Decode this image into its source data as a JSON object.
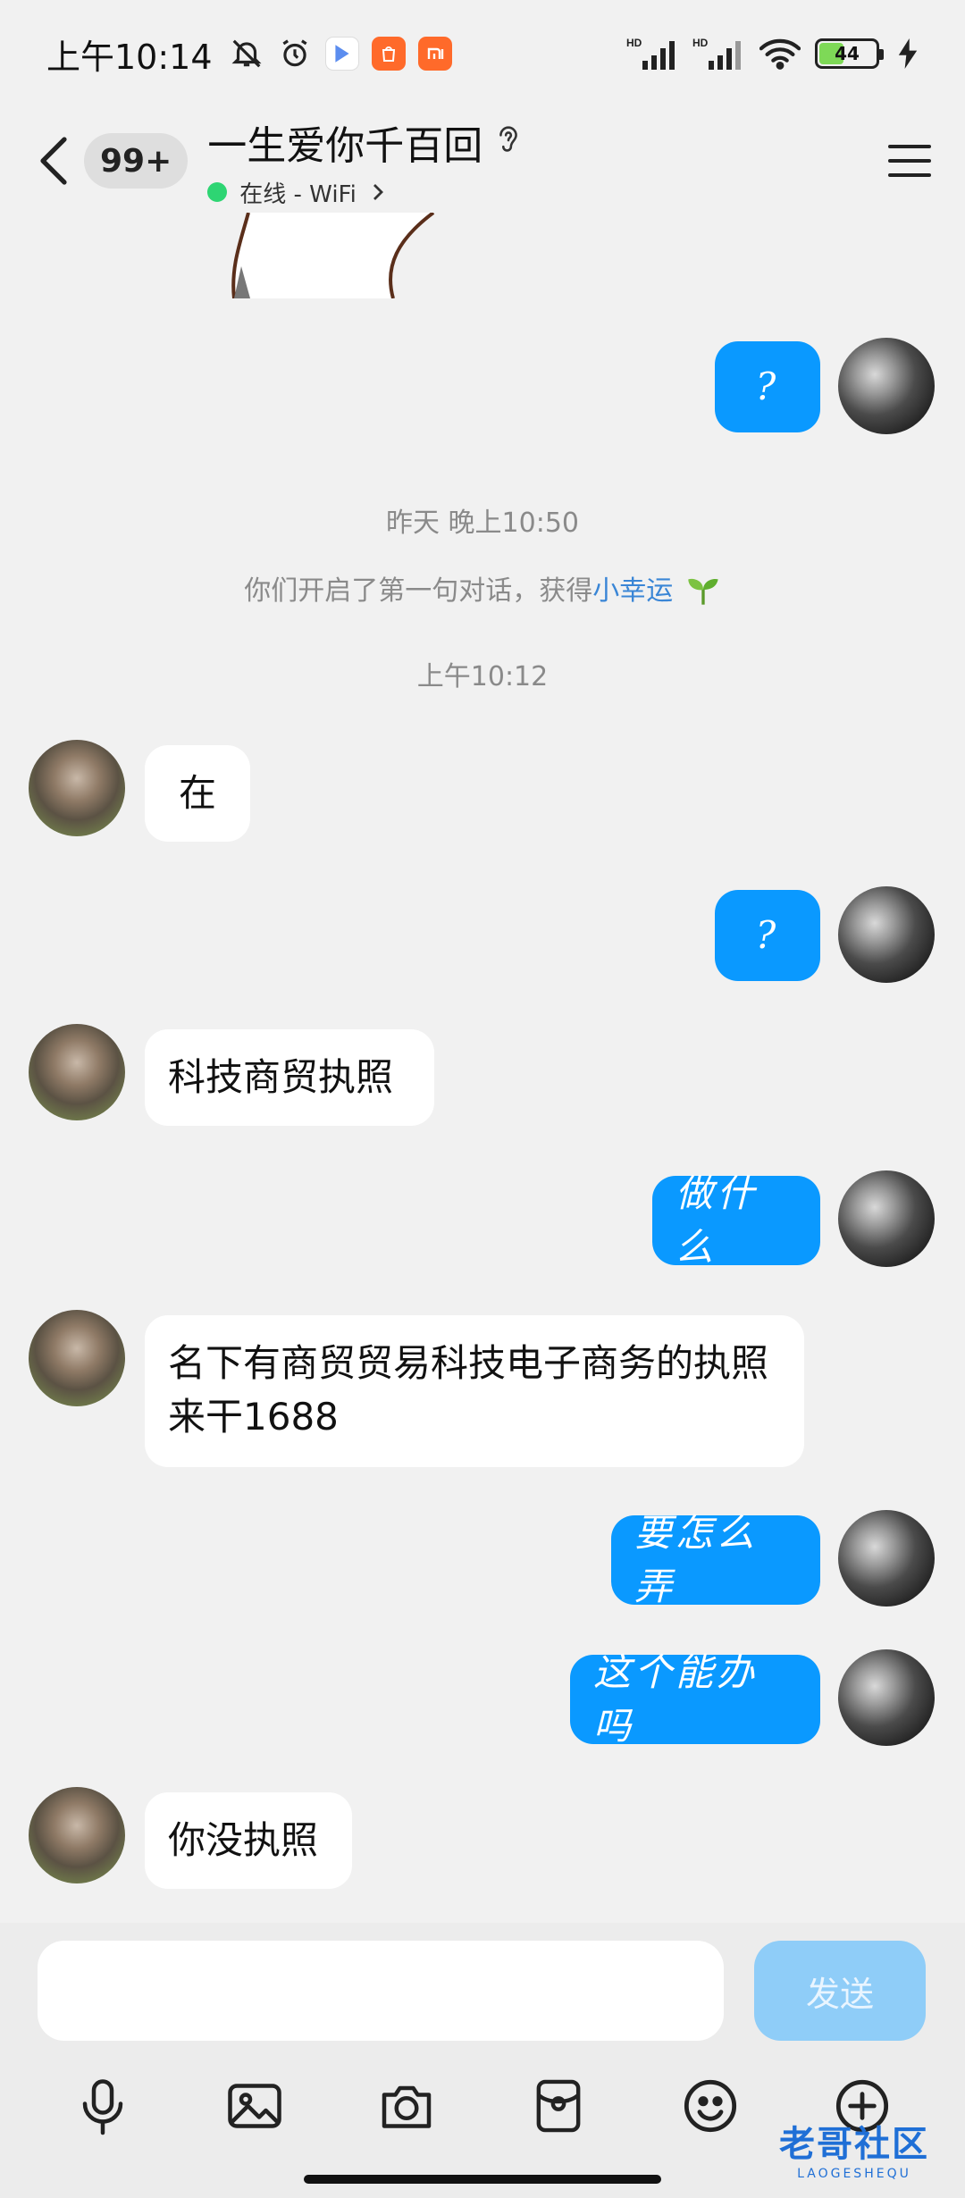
{
  "status_bar": {
    "time": "上午10:14",
    "battery_level": "44",
    "network_label_1": "HD",
    "network_label_2": "HD"
  },
  "header": {
    "unread_count": "99+",
    "contact_name": "一生爱你千百回",
    "online_status": "在线 - WiFi"
  },
  "messages": [
    {
      "from": "me",
      "text": "?"
    },
    {
      "from": "her",
      "text": "在"
    },
    {
      "from": "me",
      "text": "?"
    },
    {
      "from": "her",
      "text": "科技商贸执照"
    },
    {
      "from": "me",
      "text": "做什么"
    },
    {
      "from": "her",
      "text": "名下有商贸贸易科技电子商务的执照来干1688"
    },
    {
      "from": "me",
      "text": "要怎么弄"
    },
    {
      "from": "me",
      "text": "这个能办吗"
    },
    {
      "from": "her",
      "text": "你没执照"
    }
  ],
  "system": {
    "timestamp_1": "昨天 晚上10:50",
    "first_chat_prefix": "你们开启了第一句对话，获得",
    "first_chat_link": "小幸运",
    "timestamp_2": "上午10:12"
  },
  "composer": {
    "input_value": "",
    "send_label": "发送"
  },
  "watermark": {
    "main": "老哥社区",
    "sub": "LAOGESHEQU"
  },
  "colors": {
    "my_bubble": "#0a99ff",
    "her_bubble": "#ffffff",
    "background": "#f1f1f1",
    "send_button": "#8fcdf8"
  }
}
